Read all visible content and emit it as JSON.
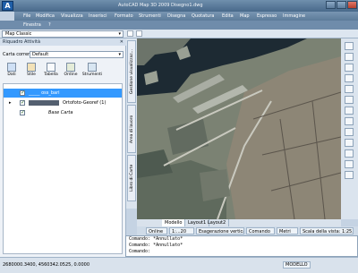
{
  "titlebar": {
    "app_icon": "A",
    "title": "AutoCAD Map 3D 2009 Disegno1.dwg"
  },
  "menu": [
    "File",
    "Modifica",
    "Visualizza",
    "Inserisci",
    "Formato",
    "Strumenti",
    "Disegna",
    "Quotatura",
    "Edita",
    "Map",
    "Espresso",
    "Immagine"
  ],
  "menu2": [
    "Finestra",
    "?"
  ],
  "toolbar": {
    "workspace": "Map Classic"
  },
  "panel": {
    "title": "Riquadro Attività",
    "current_map_label": "Carta corrente:",
    "current_map_value": "Default",
    "tools": [
      "Dati",
      "Stile",
      "Tabella",
      "Ordine",
      "Strumenti"
    ],
    "layers": [
      {
        "name": "_____ oss_bari",
        "checked": true,
        "selected": true
      },
      {
        "name": "Ortofoto-Georef (1)",
        "checked": true,
        "selected": false
      },
      {
        "name": "Base Carta",
        "checked": true,
        "selected": false
      }
    ],
    "side_tabs": [
      "Gestione visualizzaz...",
      "Area di lavoro",
      "Libro di Carte"
    ]
  },
  "layout_tabs": [
    "Modello",
    "Layout1",
    "Layout2"
  ],
  "status": {
    "online": "Online",
    "scale": "1:...20",
    "scale_vert": "Esagerazione verticale: 1x",
    "command": "Comando",
    "unit": "Metri",
    "view_scale": "Scala della vista: 1:25..."
  },
  "command_lines": [
    "Comando: *Annullato*",
    "Comando: *Annullato*",
    "Comando:"
  ],
  "bottom": {
    "coords": "2680000.3400, 4560342.0525, 0.0000",
    "model": "MODELLO"
  }
}
